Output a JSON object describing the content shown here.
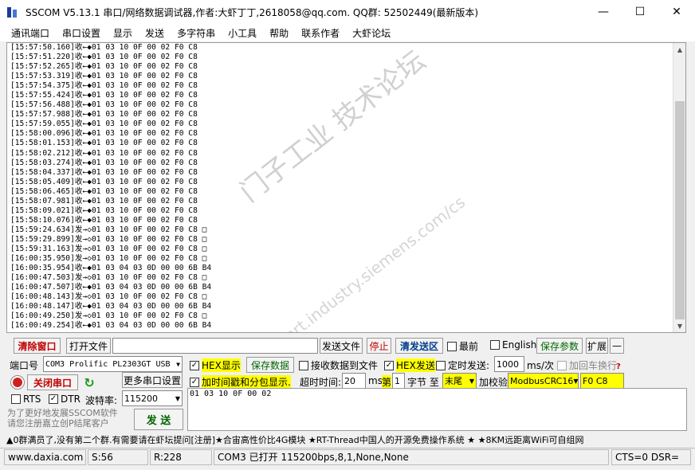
{
  "window": {
    "title": "SSCOM V5.13.1 串口/网络数据调试器,作者:大虾丁丁,2618058@qq.com. QQ群: 52502449(最新版本)",
    "minimize": "—",
    "maximize": "☐",
    "close": "✕"
  },
  "menu": [
    "通讯端口",
    "串口设置",
    "显示",
    "发送",
    "多字符串",
    "小工具",
    "帮助",
    "联系作者",
    "大虾论坛"
  ],
  "log": [
    "[15:57:50.160]收←◆01 03 10 0F 00 02 F0 C8",
    "[15:57:51.220]收←◆01 03 10 0F 00 02 F0 C8",
    "[15:57:52.265]收←◆01 03 10 0F 00 02 F0 C8",
    "[15:57:53.319]收←◆01 03 10 0F 00 02 F0 C8",
    "[15:57:54.375]收←◆01 03 10 0F 00 02 F0 C8",
    "[15:57:55.424]收←◆01 03 10 0F 00 02 F0 C8",
    "[15:57:56.488]收←◆01 03 10 0F 00 02 F0 C8",
    "[15:57:57.988]收←◆01 03 10 0F 00 02 F0 C8",
    "[15:57:59.055]收←◆01 03 10 0F 00 02 F0 C8",
    "[15:58:00.096]收←◆01 03 10 0F 00 02 F0 C8",
    "[15:58:01.153]收←◆01 03 10 0F 00 02 F0 C8",
    "[15:58:02.212]收←◆01 03 10 0F 00 02 F0 C8",
    "[15:58:03.274]收←◆01 03 10 0F 00 02 F0 C8",
    "[15:58:04.337]收←◆01 03 10 0F 00 02 F0 C8",
    "[15:58:05.409]收←◆01 03 10 0F 00 02 F0 C8",
    "[15:58:06.465]收←◆01 03 10 0F 00 02 F0 C8",
    "[15:58:07.981]收←◆01 03 10 0F 00 02 F0 C8",
    "[15:58:09.021]收←◆01 03 10 0F 00 02 F0 C8",
    "[15:58:10.076]收←◆01 03 10 0F 00 02 F0 C8",
    "[15:59:24.634]发→◇01 03 10 0F 00 02 F0 C8 □",
    "[15:59:29.899]发→◇01 03 10 0F 00 02 F0 C8 □",
    "[15:59:31.163]发→◇01 03 10 0F 00 02 F0 C8 □",
    "[16:00:35.950]发→◇01 03 10 0F 00 02 F0 C8 □",
    "[16:00:35.954]收←◆01 03 04 03 0D 00 00 6B B4",
    "[16:00:47.503]发→◇01 03 10 0F 00 02 F0 C8 □",
    "[16:00:47.507]收←◆01 03 04 03 0D 00 00 6B B4",
    "[16:00:48.143]发→◇01 03 10 0F 00 02 F0 C8 □",
    "[16:00:48.147]收←◆01 03 04 03 0D 00 00 6B B4",
    "[16:00:49.250]发→◇01 03 10 0F 00 02 F0 C8 □",
    "[16:00:49.254]收←◆01 03 04 03 0D 00 00 6B B4"
  ],
  "watermark": {
    "line1": "门子工业  技术论坛",
    "line2": "support.industry.siemens.com/cs"
  },
  "toolbar": {
    "clear": "清除窗口",
    "open_file": "打开文件",
    "send_file": "发送文件",
    "stop": "停止",
    "clear_send": "清发送区",
    "topmost": "最前",
    "english": "English",
    "save_params": "保存参数",
    "expand": "扩展",
    "collapse": "—"
  },
  "port": {
    "label": "端口号",
    "value": "COM3 Prolific PL2303GT USB",
    "close_port": "关闭串口",
    "more_settings": "更多串口设置",
    "rts": "RTS",
    "dtr": "DTR",
    "baud_label": "波特率:",
    "baud_value": "115200"
  },
  "options": {
    "hex_display": "HEX显示",
    "save_data": "保存数据",
    "recv_to_file": "接收数据到文件",
    "hex_send": "HEX发送",
    "timed_send": "定时发送:",
    "interval": "1000",
    "interval_unit": "ms/次",
    "add_crlf": "加回车换行",
    "timestamp": "加时间戳和分包显示.",
    "timeout_label": "超时时间:",
    "timeout_value": "20",
    "timeout_unit": "ms",
    "nth_label": "第",
    "nth_value": "1",
    "byte_to": "字节 至",
    "end_value": "末尾",
    "checksum_label": "加校验",
    "checksum_value": "ModbusCRC16",
    "crc_value": "F0 C8"
  },
  "send": {
    "input": "01 03 10 0F 00 02",
    "button": "发 送",
    "promo": "为了更好地发展SSCOM软件\n请您注册嘉立创P结尾客户"
  },
  "marquee": "▲0群满员了,没有第二个群.有需要请在虾坛提问[注册]★合宙高性价比4G模块 ★RT-Thread中国人的开源免费操作系统 ★ ★8KM远距离WiFi可自组网",
  "status": {
    "site": "www.daxia.com",
    "sent": "S:56",
    "recv": "R:228",
    "port_state": "COM3 已打开  115200bps,8,1,None,None",
    "lines": "CTS=0 DSR="
  }
}
